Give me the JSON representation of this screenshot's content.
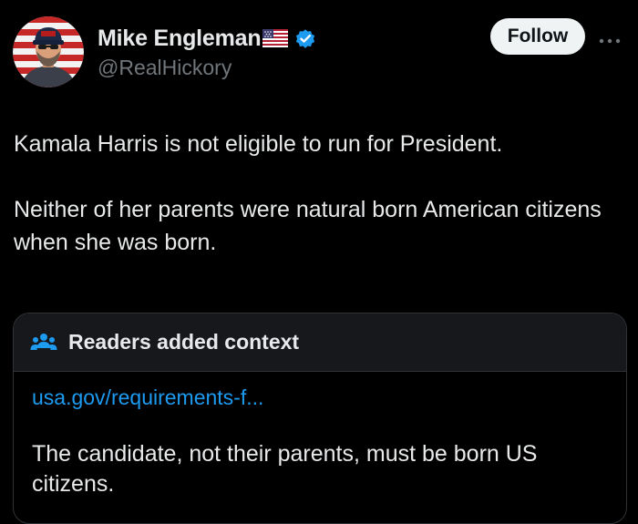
{
  "user": {
    "display_name": "Mike Engleman",
    "handle": "@RealHickory",
    "flag_icon": "us-flag-icon",
    "verified_icon": "verified-badge-icon",
    "verified_color": "#1d9bf0"
  },
  "actions": {
    "follow_label": "Follow",
    "more_icon": "more-options-icon"
  },
  "tweet": {
    "paragraph_1": "Kamala Harris is not eligible to run for President.",
    "paragraph_2": "Neither of her parents were natural born American citizens when she was born."
  },
  "community_note": {
    "icon": "people-icon",
    "title": "Readers added context",
    "link_text": "usa.gov/requirements-f...",
    "body": "The candidate, not their parents, must be born US citizens.",
    "link_color": "#1d9bf0"
  },
  "colors": {
    "background": "#000000",
    "text_primary": "#e7e9ea",
    "text_secondary": "#71767b",
    "card_header": "#16181c",
    "border": "#2f3336"
  }
}
